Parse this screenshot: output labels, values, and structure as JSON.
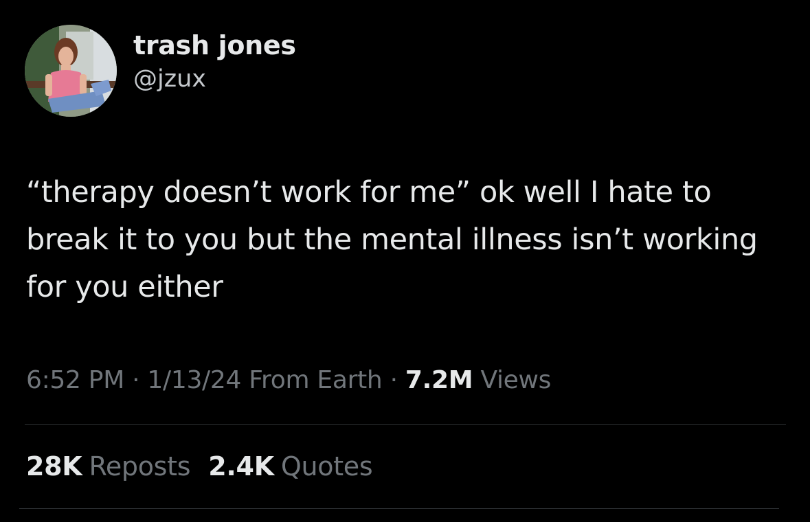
{
  "author": {
    "display_name": "trash jones",
    "handle": "@jzux"
  },
  "tweet": {
    "text": "“therapy doesn’t work for me” ok well I hate to break it to you but the mental illness isn’t working for you either"
  },
  "meta": {
    "time": "6:52 PM",
    "separator1": " · ",
    "date": "1/13/24",
    "source": "From Earth",
    "separator2": " · ",
    "views_count": "7.2M",
    "views_label": "Views"
  },
  "stats": {
    "reposts_count": "28K",
    "reposts_label": "Reposts",
    "quotes_count": "2.4K",
    "quotes_label": "Quotes"
  },
  "colors": {
    "background": "#000000",
    "primary_text": "#e7e9ea",
    "secondary_text": "#71767b",
    "divider": "#2f3336"
  }
}
